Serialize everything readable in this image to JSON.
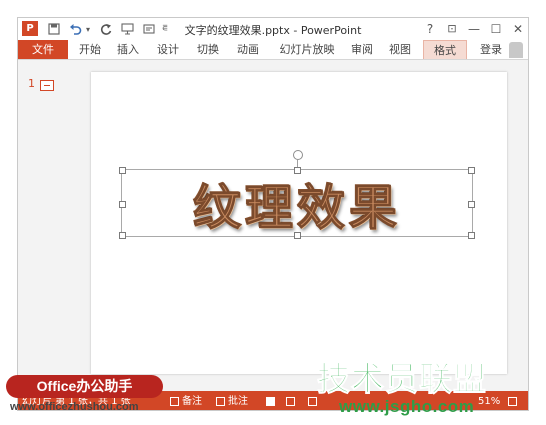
{
  "window": {
    "title": "文字的纹理效果.pptx - PowerPoint",
    "app_icon_label": "P",
    "controls": {
      "help": "?",
      "restore_ribbon": "⊡",
      "minimize": "—",
      "maximize": "☐",
      "close": "✕"
    }
  },
  "quick_access": [
    "save-icon",
    "undo-icon",
    "redo-icon",
    "present-icon",
    "customize-icon"
  ],
  "tabs": [
    {
      "label": "文件"
    },
    {
      "label": "开始"
    },
    {
      "label": "插入"
    },
    {
      "label": "设计"
    },
    {
      "label": "切换"
    },
    {
      "label": "动画"
    },
    {
      "label": "幻灯片放映"
    },
    {
      "label": "审阅"
    },
    {
      "label": "视图"
    },
    {
      "label": "格式"
    }
  ],
  "login_label": "登录",
  "thumbnails": [
    {
      "number": "1"
    }
  ],
  "slide": {
    "wordart_text": "纹理效果"
  },
  "status": {
    "slide_info": "幻灯片 第 1 张，共 1 张",
    "notes_label": "备注",
    "comments_label": "批注",
    "zoom": "51%"
  },
  "colors": {
    "accent": "#d24726",
    "wordart_fill": "#c98b60"
  },
  "watermarks": {
    "badge": "Office办公助手",
    "site": "www.officezhushou.com",
    "brand": "技术员联盟",
    "brand_url": "www.jsgho.com"
  }
}
